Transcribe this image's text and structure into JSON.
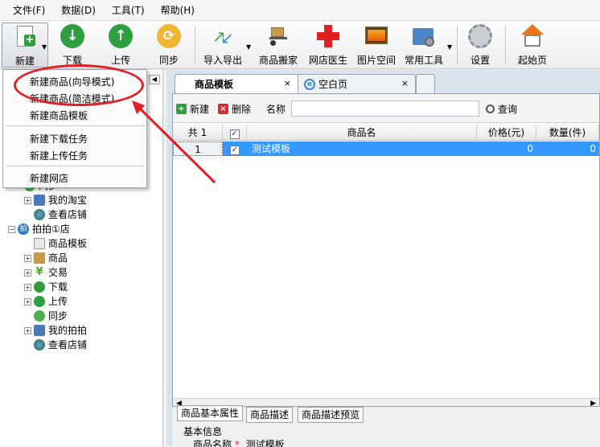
{
  "menu": [
    "文件(F)",
    "数据(D)",
    "工具(T)",
    "帮助(H)"
  ],
  "toolbar": [
    {
      "label": "新建",
      "icon": "new-doc-icon"
    },
    {
      "label": "下载",
      "icon": "download-icon"
    },
    {
      "label": "上传",
      "icon": "upload-icon"
    },
    {
      "label": "同步",
      "icon": "sync-icon"
    },
    {
      "label": "导入导出",
      "icon": "import-export-icon"
    },
    {
      "label": "商品搬家",
      "icon": "hand-truck-icon"
    },
    {
      "label": "网店医生",
      "icon": "red-cross-icon"
    },
    {
      "label": "图片空间",
      "icon": "image-icon"
    },
    {
      "label": "常用工具",
      "icon": "folder-tools-icon"
    },
    {
      "label": "设置",
      "icon": "gear-icon"
    },
    {
      "label": "起始页",
      "icon": "home-icon"
    }
  ],
  "dropdown": [
    "新建商品(向导模式)",
    "新建商品(简洁模式)",
    "新建商品模板",
    "新建下载任务",
    "新建上传任务",
    "新建网店"
  ],
  "tree": [
    {
      "label": "同步",
      "icon": "sync-icon"
    },
    {
      "label": "我的淘宝",
      "icon": "network-icon"
    },
    {
      "label": "查看店铺",
      "icon": "globe-icon"
    },
    {
      "label": "拍拍①店",
      "icon": "paipai-icon",
      "badge": "拍"
    },
    {
      "label": "商品模板",
      "icon": "template-icon"
    },
    {
      "label": "商品",
      "icon": "box-icon"
    },
    {
      "label": "交易",
      "icon": "yen-icon",
      "badge": "¥"
    },
    {
      "label": "下载",
      "icon": "download-icon"
    },
    {
      "label": "上传",
      "icon": "upload-icon"
    },
    {
      "label": "同步",
      "icon": "sync-icon"
    },
    {
      "label": "我的拍拍",
      "icon": "network-icon"
    },
    {
      "label": "查看店铺",
      "icon": "globe-icon"
    }
  ],
  "tabs": [
    {
      "label": "商品模板",
      "close": "×"
    },
    {
      "label": "空白页",
      "close": "×"
    }
  ],
  "grid_toolbar": {
    "new": "新建",
    "delete": "删除",
    "name_label": "名称",
    "search": "查询",
    "name_value": ""
  },
  "grid": {
    "headers": {
      "rownum": "共 1",
      "name": "商品名",
      "price": "价格(元)",
      "qty": "数量(件)"
    },
    "rows": [
      {
        "num": "1",
        "name": "测试模板",
        "price": "0",
        "qty": "0"
      }
    ]
  },
  "bottom_tabs": [
    "商品基本属性",
    "商品描述",
    "商品描述预览"
  ],
  "bottom": {
    "section": "基本信息",
    "name_label": "商品名称",
    "name_value": "测试模板"
  },
  "colors": {
    "annotation": "#e31e24",
    "selection": "#3399ff",
    "accent_green": "#2e9e3e"
  }
}
